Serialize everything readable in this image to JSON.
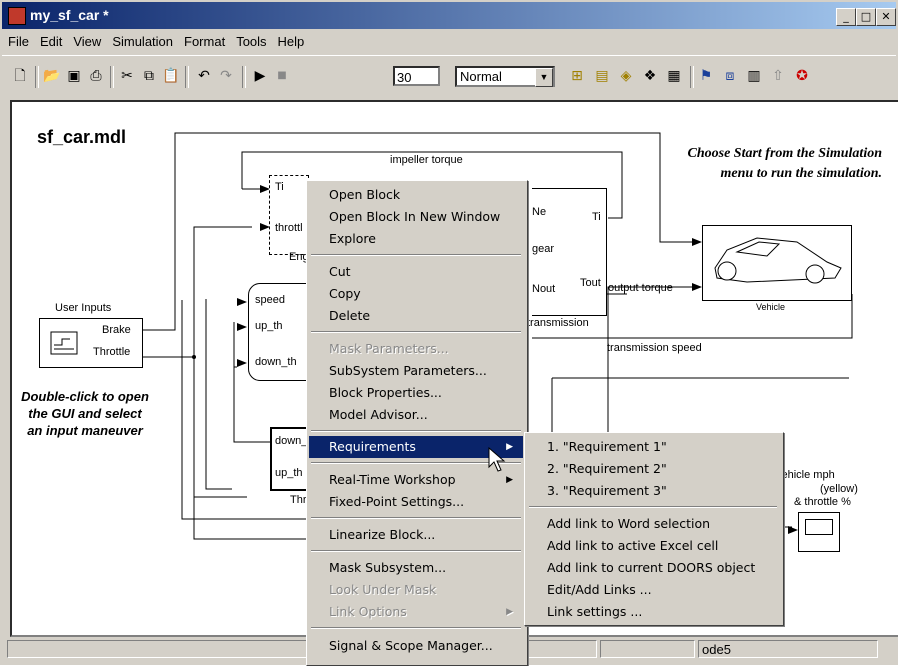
{
  "window": {
    "title": "my_sf_car *"
  },
  "menubar": [
    "File",
    "Edit",
    "View",
    "Simulation",
    "Format",
    "Tools",
    "Help"
  ],
  "toolbar": {
    "stop_time": "30",
    "sim_mode": "Normal",
    "icons": [
      "new-icon",
      "open-icon",
      "save-icon",
      "print-icon",
      "cut-icon",
      "copy-icon",
      "paste-icon",
      "undo-icon",
      "redo-icon",
      "start-icon",
      "stop-icon",
      "library-browser-icon",
      "toggle-model-browser-icon",
      "debug-icon",
      "build-icon",
      "update-diagram-icon",
      "model-advisor-icon",
      "explorer-icon",
      "properties-icon",
      "parent-icon",
      "help-icon"
    ]
  },
  "diagram": {
    "title": "sf_car.mdl",
    "instructions": "Choose Start from the Simulation menu to run the simulation.",
    "user_inputs_label": "User Inputs",
    "brake_port": "Brake",
    "throttle_port": "Throttle",
    "double_click_text": "Double-click to open the GUI and select an input maneuver",
    "engine_ports": [
      "Ti",
      "throttl"
    ],
    "engine_name": "Eng",
    "impeller_torque": "impeller torque",
    "shift_ports": [
      "speed",
      "up_th",
      "down_th"
    ],
    "threshold_ports": [
      "down_",
      "up_th"
    ],
    "threshold_name": "Thr",
    "transmission_ports_in": [
      "Ne",
      "gear",
      "Nout"
    ],
    "transmission_ports_out": [
      "Ti",
      "Tout"
    ],
    "transmission_name": "transmission",
    "output_torque": "output torque",
    "vehicle_name": "Vehicle",
    "transmission_speed": "transmission speed",
    "scope_label_1": "vehicle mph",
    "scope_label_2": "(yellow)",
    "scope_label_3": "& throttle %"
  },
  "context_menu": {
    "items": [
      {
        "label": "Open Block",
        "enabled": true
      },
      {
        "label": "Open Block In New Window",
        "enabled": true
      },
      {
        "label": "Explore",
        "enabled": true
      },
      {
        "label": "Cut",
        "enabled": true
      },
      {
        "label": "Copy",
        "enabled": true
      },
      {
        "label": "Delete",
        "enabled": true
      },
      {
        "label": "Mask Parameters...",
        "enabled": false
      },
      {
        "label": "SubSystem Parameters...",
        "enabled": true
      },
      {
        "label": "Block Properties...",
        "enabled": true
      },
      {
        "label": "Model Advisor...",
        "enabled": true
      },
      {
        "label": "Requirements",
        "enabled": true,
        "selected": true
      },
      {
        "label": "Real-Time Workshop",
        "enabled": true
      },
      {
        "label": "Fixed-Point Settings...",
        "enabled": true
      },
      {
        "label": "Linearize Block...",
        "enabled": true
      },
      {
        "label": "Mask Subsystem...",
        "enabled": true
      },
      {
        "label": "Look Under Mask",
        "enabled": false
      },
      {
        "label": "Link Options",
        "enabled": false
      },
      {
        "label": "Signal & Scope Manager...",
        "enabled": true
      }
    ]
  },
  "submenu": {
    "items": [
      "1. \"Requirement 1\"",
      "2. \"Requirement 2\"",
      "3. \"Requirement 3\"",
      "Add link to Word selection",
      "Add link to active Excel cell",
      "Add link to current DOORS object",
      "Edit/Add Links ...",
      "Link settings ..."
    ]
  },
  "statusbar": {
    "solver": "ode5"
  }
}
